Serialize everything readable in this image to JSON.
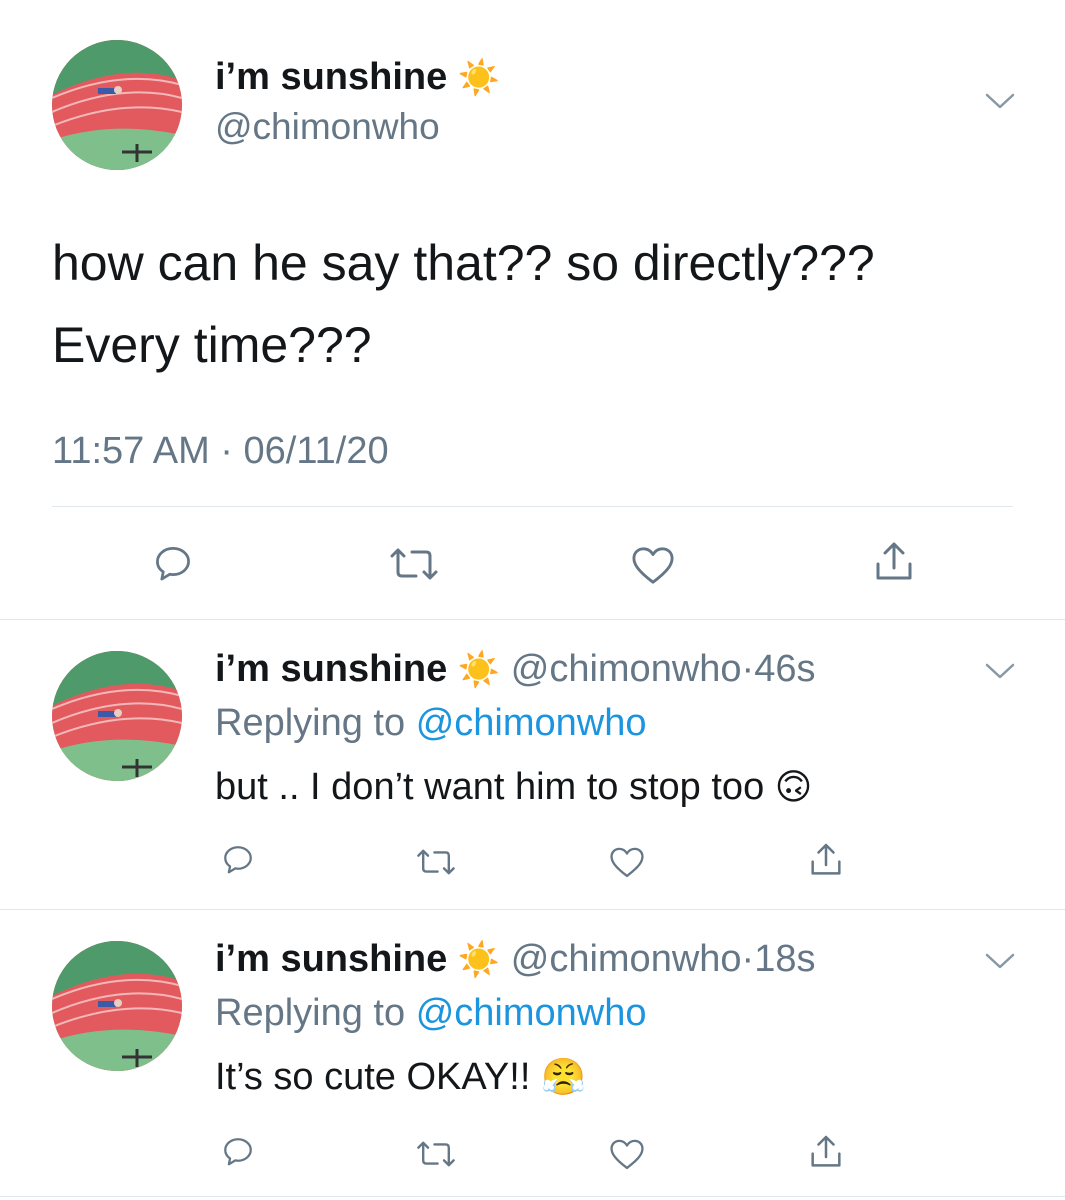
{
  "main_tweet": {
    "display_name": "i’m sunshine",
    "name_emoji": "☀️",
    "handle": "@chimonwho",
    "text_line1": "how can he say that?? so directly???",
    "text_line2": "Every time???",
    "time": "11:57 AM",
    "separator": "·",
    "date": "06/11/20"
  },
  "replies": [
    {
      "display_name": "i’m sunshine",
      "name_emoji": "☀️",
      "handle": "@chimonwho",
      "separator": "·",
      "age": "46s",
      "replying_prefix": "Replying to",
      "replying_handle": "@chimonwho",
      "text": "but .. I don’t want him to stop too",
      "emoji": "🙃"
    },
    {
      "display_name": "i’m sunshine",
      "name_emoji": "☀️",
      "handle": "@chimonwho",
      "separator": "·",
      "age": "18s",
      "replying_prefix": "Replying to",
      "replying_handle": "@chimonwho",
      "text": "It’s so cute OKAY!!",
      "emoji": "😤"
    }
  ],
  "icons": [
    "avatar-photo",
    "sun-emoji",
    "chevron-down-icon",
    "reply-icon",
    "retweet-icon",
    "like-icon",
    "share-icon"
  ],
  "colors": {
    "link": "#1b95e0",
    "muted": "#657786",
    "text": "#14171a",
    "icon": "#657786",
    "divider": "#e1e8ed"
  }
}
